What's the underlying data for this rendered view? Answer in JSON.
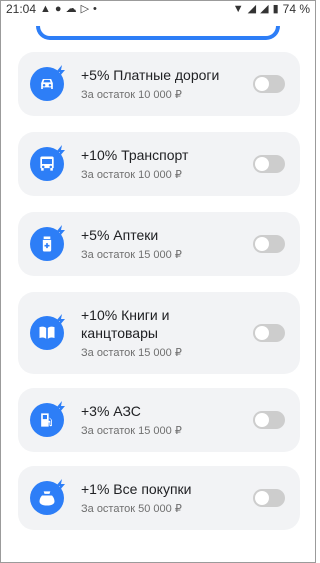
{
  "status": {
    "time": "21:04",
    "battery": "74 %"
  },
  "items": [
    {
      "title": "+5% Платные дороги",
      "subtitle": "За остаток 10 000 ₽",
      "icon": "car-icon",
      "enabled": false
    },
    {
      "title": "+10% Транспорт",
      "subtitle": "За остаток 10 000 ₽",
      "icon": "bus-icon",
      "enabled": false
    },
    {
      "title": "+5% Аптеки",
      "subtitle": "За остаток 15 000 ₽",
      "icon": "pharmacy-icon",
      "enabled": false
    },
    {
      "title": "+10% Книги и канцтовары",
      "subtitle": "За остаток 15 000 ₽",
      "icon": "book-icon",
      "enabled": false
    },
    {
      "title": "+3% АЗС",
      "subtitle": "За остаток 15 000 ₽",
      "icon": "fuel-pump-icon",
      "enabled": false
    },
    {
      "title": "+1% Все покупки",
      "subtitle": "За остаток 50 000 ₽",
      "icon": "shopping-bag-icon",
      "enabled": false
    }
  ],
  "colors": {
    "accent": "#2d7ef7",
    "card": "#f2f3f5",
    "toggle_off": "#cdcdcd"
  }
}
